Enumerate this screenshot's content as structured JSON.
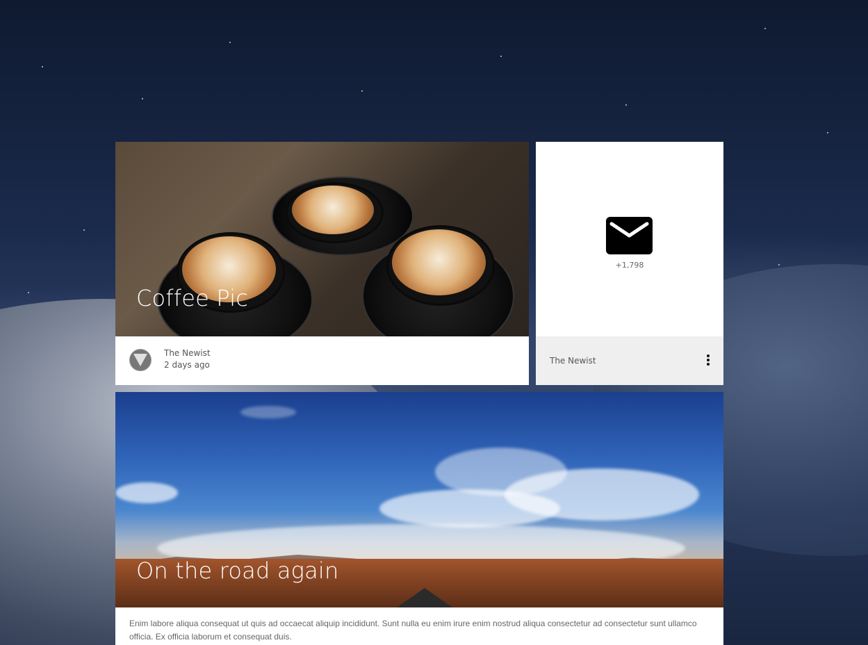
{
  "cards": {
    "coffee": {
      "title": "Coffee Pic",
      "author": "The Newist",
      "time": "2 days ago"
    },
    "mail": {
      "icon": "mail-icon",
      "count": "+1,798",
      "author": "The Newist",
      "menu_icon": "more-vertical-icon"
    },
    "road": {
      "title": "On the road again",
      "description": "Enim labore aliqua consequat ut quis ad occaecat aliquip incididunt. Sunt nulla eu enim irure enim nostrud aliqua consectetur ad consectetur sunt ullamco officia. Ex officia laborum et consequat duis."
    }
  },
  "colors": {
    "card_bg": "#ffffff",
    "mail_footer_bg": "#efefef",
    "text_muted": "#555555"
  }
}
